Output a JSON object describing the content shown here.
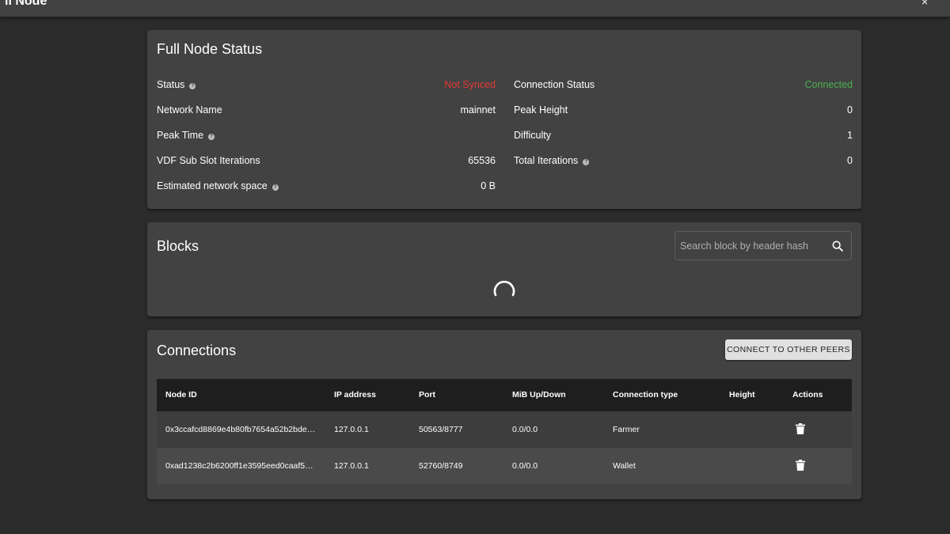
{
  "window": {
    "title": "ll Node",
    "close_glyph": "×"
  },
  "status": {
    "title": "Full Node Status",
    "left": [
      {
        "label": "Status",
        "value": "Not Synced",
        "help": true,
        "tone": "red"
      },
      {
        "label": "Network Name",
        "value": "mainnet",
        "help": false,
        "tone": ""
      },
      {
        "label": "Peak Time",
        "value": "",
        "help": true,
        "tone": ""
      },
      {
        "label": "VDF Sub Slot Iterations",
        "value": "65536",
        "help": false,
        "tone": ""
      },
      {
        "label": "Estimated network space",
        "value": "0 B",
        "help": true,
        "tone": ""
      }
    ],
    "right": [
      {
        "label": "Connection Status",
        "value": "Connected",
        "help": false,
        "tone": "green"
      },
      {
        "label": "Peak Height",
        "value": "0",
        "help": false,
        "tone": ""
      },
      {
        "label": "Difficulty",
        "value": "1",
        "help": false,
        "tone": ""
      },
      {
        "label": "Total Iterations",
        "value": "0",
        "help": true,
        "tone": ""
      }
    ]
  },
  "blocks": {
    "title": "Blocks",
    "search_placeholder": "Search block by header hash",
    "loading_icon": "spinner-icon"
  },
  "connections": {
    "title": "Connections",
    "peer_button": "CONNECT TO OTHER PEERS",
    "columns": [
      "Node ID",
      "IP address",
      "Port",
      "MiB Up/Down",
      "Connection type",
      "Height",
      "Actions"
    ],
    "rows": [
      {
        "node_id": "0x3ccafcd8869e4b80fb7654a52b2bde…",
        "ip": "127.0.0.1",
        "port": "50563/8777",
        "mib": "0.0/0.0",
        "type": "Farmer",
        "height": ""
      },
      {
        "node_id": "0xad1238c2b6200ff1e3595eed0caaf5…",
        "ip": "127.0.0.1",
        "port": "52760/8749",
        "mib": "0.0/0.0",
        "type": "Wallet",
        "height": ""
      }
    ],
    "delete_icon": "trash-icon"
  },
  "colors": {
    "red": "#e53935",
    "green": "#4caf50",
    "card": "#424242",
    "background": "#2b2b2b"
  }
}
